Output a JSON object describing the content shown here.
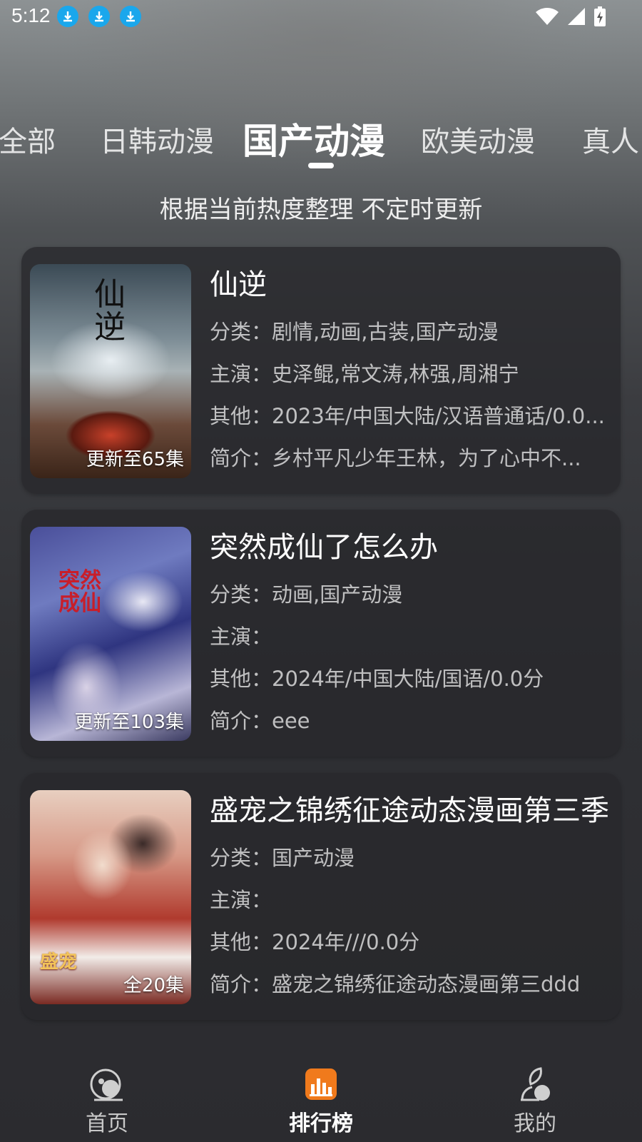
{
  "status_bar": {
    "time": "5:12"
  },
  "tabs": [
    {
      "label": "全部"
    },
    {
      "label": "日韩动漫"
    },
    {
      "label": "国产动漫"
    },
    {
      "label": "欧美动漫"
    },
    {
      "label": "真人"
    }
  ],
  "active_tab": "国产动漫",
  "subtitle": "根据当前热度整理 不定时更新",
  "cards": [
    {
      "title": "仙逆",
      "badge": "更新至65集",
      "category": "分类：剧情,动画,古装,国产动漫",
      "cast": "主演：史泽鲲,常文涛,林强,周湘宁",
      "other": "其他：2023年/中国大陆/汉语普通话/0.0...",
      "intro": "简介：乡村平凡少年王林，为了心中不...",
      "colors": [
        "#2d3a44",
        "#6f8290",
        "#8a3a20"
      ]
    },
    {
      "title": "突然成仙了怎么办",
      "badge": "更新至103集",
      "category": "分类：动画,国产动漫",
      "cast": "主演：",
      "other": "其他：2024年/中国大陆/国语/0.0分",
      "intro": "简介：eee",
      "colors": [
        "#3a3f7a",
        "#8a96c8",
        "#2a2a55"
      ]
    },
    {
      "title": "盛宠之锦绣征途动态漫画第三季",
      "badge": "全20集",
      "category": "分类：国产动漫",
      "cast": "主演：",
      "other": "其他：2024年///0.0分",
      "intro": "简介：盛宠之锦绣征途动态漫画第三ddd",
      "colors": [
        "#b24a3a",
        "#e8c6b0",
        "#5a2a28"
      ]
    }
  ],
  "bottom_nav": [
    {
      "label": "首页",
      "icon": "home-icon"
    },
    {
      "label": "排行榜",
      "icon": "ranking-icon"
    },
    {
      "label": "我的",
      "icon": "profile-icon"
    }
  ],
  "active_nav": "排行榜",
  "accent_color": "#f07a1c"
}
